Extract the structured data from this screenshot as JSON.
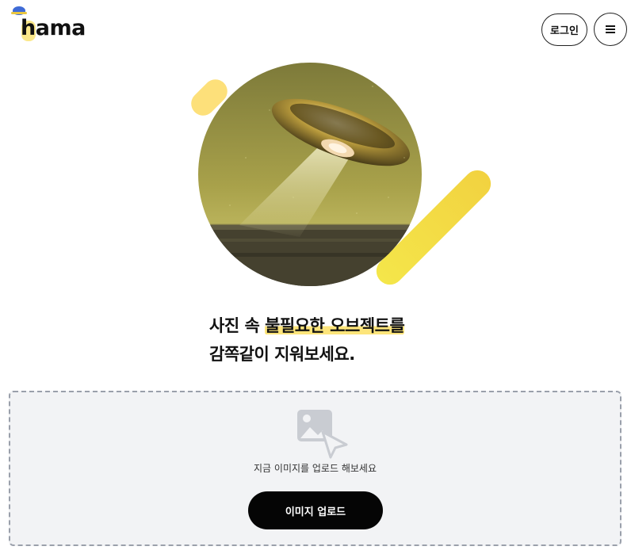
{
  "header": {
    "logo_text": "hama",
    "login_label": "로그인",
    "menu_icon": "hamburger-menu-icon"
  },
  "hero": {
    "image_description": "ufo-over-field-photo",
    "accent_colors": [
      "#fde07a",
      "#f2d240"
    ]
  },
  "headline": {
    "line1_prefix": "사진 속 ",
    "line1_highlight": "불필요한 오브젝트를",
    "line2": "감쪽같이 지워보세요."
  },
  "upload": {
    "icon": "image-upload-icon",
    "prompt": "지금 이미지를 업로드 해보세요",
    "button_label": "이미지 업로드"
  }
}
